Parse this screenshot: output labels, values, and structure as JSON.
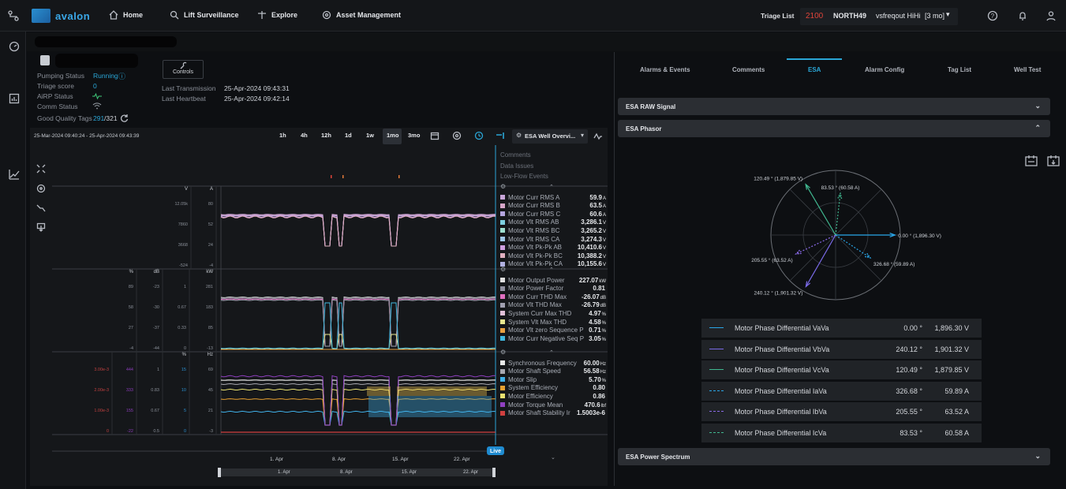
{
  "topbar": {
    "brand": "avalon",
    "nav": [
      "Home",
      "Lift Surveillance",
      "Explore",
      "Asset Management"
    ],
    "triage_label": "Triage List",
    "triage_count": "2100",
    "well": "NORTH49",
    "alarm": "vsfreqout HiHi",
    "period": "[3 mo]"
  },
  "well_info": {
    "pumping_status_label": "Pumping Status",
    "pumping_status_value": "Running",
    "triage_score_label": "Triage score",
    "triage_score_value": "0",
    "airp_label": "AiRP Status",
    "comm_label": "Comm Status",
    "good_tags_label": "Good Quality Tags",
    "good_tags_value": "291",
    "good_tags_total": "/321",
    "controls_label": "Controls",
    "last_tx_label": "Last Transmission",
    "last_tx_value": "25-Apr-2024 09:43:31",
    "last_hb_label": "Last Heartbeat",
    "last_hb_value": "25-Apr-2024 09:42:14"
  },
  "chart_toolbar": {
    "range": "25-Mar-2024 09:40:24 - 25-Apr-2024 09:43:39",
    "buttons": [
      "1h",
      "4h",
      "12h",
      "1d",
      "1w",
      "1mo",
      "3mo"
    ],
    "active": "1mo",
    "view_select": "ESA Well Overvi..."
  },
  "event_lanes": [
    "Comments",
    "Data Issues",
    "Low-Flow Events"
  ],
  "x_axis": {
    "ticks": [
      "1. Apr",
      "8. Apr",
      "15. Apr",
      "22. Apr"
    ],
    "live_label": "Live"
  },
  "colors": {
    "accent": "#2aa6d6",
    "status_ok": "#2aa6d6",
    "triage": "#e0443a",
    "panel": "#15171a"
  },
  "chart_data": [
    {
      "type": "line",
      "y_axes": [
        {
          "unit": "V",
          "ticks": [
            "12.05k",
            "7860",
            "3668",
            "-524"
          ]
        },
        {
          "unit": "A",
          "ticks": [
            "80",
            "52",
            "24",
            "-4"
          ]
        }
      ],
      "series": [
        {
          "name": "Motor Curr RMS A",
          "value": "59.9",
          "unit": "A",
          "color": "#c9a6d9"
        },
        {
          "name": "Motor Curr RMS B",
          "value": "63.5",
          "unit": "A",
          "color": "#d6a6c9"
        },
        {
          "name": "Motor Curr RMS C",
          "value": "60.6",
          "unit": "A",
          "color": "#b5a6e0"
        },
        {
          "name": "Motor Vlt RMS AB",
          "value": "3,286.1",
          "unit": "V",
          "color": "#7ed0e0"
        },
        {
          "name": "Motor Vlt RMS BC",
          "value": "3,265.2",
          "unit": "V",
          "color": "#9ee0d0"
        },
        {
          "name": "Motor Vlt RMS CA",
          "value": "3,274.3",
          "unit": "V",
          "color": "#a0c8e8"
        },
        {
          "name": "Motor Vlt Pk-Pk AB",
          "value": "10,410.6",
          "unit": "V",
          "color": "#d0a0e0"
        },
        {
          "name": "Motor Vlt Pk-Pk BC",
          "value": "10,388.2",
          "unit": "V",
          "color": "#e0b0c0"
        },
        {
          "name": "Motor Vlt Pk-Pk CA",
          "value": "10,155.6",
          "unit": "V",
          "color": "#b0b0e0"
        }
      ]
    },
    {
      "type": "line",
      "y_axes": [
        {
          "unit": "%",
          "ticks": [
            "89",
            "58",
            "27",
            "-4"
          ]
        },
        {
          "unit": "dB",
          "ticks": [
            "-23",
            "-30",
            "-37",
            "-44"
          ]
        },
        {
          "unit": "",
          "ticks": [
            "1",
            "0.67",
            "0.33",
            "0"
          ]
        },
        {
          "unit": "kW",
          "ticks": [
            "281",
            "183",
            "85",
            "-13"
          ]
        }
      ],
      "series": [
        {
          "name": "Motor Output Power",
          "value": "227.07",
          "unit": "kW",
          "color": "#e0e0e0"
        },
        {
          "name": "Motor Power Factor",
          "value": "0.81",
          "unit": "",
          "color": "#9090a0"
        },
        {
          "name": "Motor Curr THD Max",
          "value": "-26.07",
          "unit": "dB",
          "color": "#e070c0"
        },
        {
          "name": "Motor Vlt THD Max",
          "value": "-26.79",
          "unit": "dB",
          "color": "#a0a0b0"
        },
        {
          "name": "System Curr Max THD",
          "value": "4.97",
          "unit": "%",
          "color": "#e0c0d8"
        },
        {
          "name": "System Vlt Max THD",
          "value": "4.58",
          "unit": "%",
          "color": "#e8e890"
        },
        {
          "name": "Motor Vlt zero Sequence P",
          "value": "0.71",
          "unit": "%",
          "color": "#e8a040"
        },
        {
          "name": "Motor Curr Negative Seq P",
          "value": "3.05",
          "unit": "%",
          "color": "#40b8e0"
        }
      ]
    },
    {
      "type": "line",
      "y_axes": [
        {
          "unit": "",
          "ticks": [
            "3.00e-3",
            "2.00e-3",
            "1.00e-3",
            "0"
          ]
        },
        {
          "unit": "",
          "ticks": [
            "444",
            "333",
            "155",
            "-22"
          ]
        },
        {
          "unit": "",
          "ticks": [
            "1",
            "0.83",
            "0.67",
            "0.5"
          ]
        },
        {
          "unit": "%",
          "ticks": [
            "15",
            "10",
            "5",
            "0"
          ]
        },
        {
          "unit": "Hz",
          "ticks": [
            "69",
            "45",
            "21",
            "-3"
          ]
        }
      ],
      "series": [
        {
          "name": "Synchronous Frequency",
          "value": "60.00",
          "unit": "Hz",
          "color": "#e8e8e8"
        },
        {
          "name": "Motor Shaft Speed",
          "value": "56.58",
          "unit": "Hz",
          "color": "#a8a8b0"
        },
        {
          "name": "Motor Slip",
          "value": "5.70",
          "unit": "%",
          "color": "#40b0e8"
        },
        {
          "name": "System Efficiency",
          "value": "0.80",
          "unit": "",
          "color": "#e8a030"
        },
        {
          "name": "Motor Efficiency",
          "value": "0.86",
          "unit": "",
          "color": "#e8e070"
        },
        {
          "name": "Motor Torque Mean",
          "value": "470.6",
          "unit": "lbf",
          "color": "#9040c0"
        },
        {
          "name": "Motor Shaft Stability Ir",
          "value": "1.5003e-6",
          "unit": "",
          "color": "#d04040"
        }
      ]
    },
    {
      "type": "scatter",
      "title": "ESA Phasor",
      "polar": true,
      "series": [
        {
          "name": "Motor Phase Differential VaVa",
          "angle": 0.0,
          "magnitude": 1896.3,
          "unit": "V",
          "color": "#2aa6e8",
          "dashed": false,
          "label": "0.00 ° (1,896.30 V)"
        },
        {
          "name": "Motor Phase Differential VbVa",
          "angle": 240.12,
          "magnitude": 1901.32,
          "unit": "V",
          "color": "#7a6ae8",
          "dashed": false,
          "label": "240.12 ° (1,901.32 V)"
        },
        {
          "name": "Motor Phase Differential VcVa",
          "angle": 120.49,
          "magnitude": 1879.85,
          "unit": "V",
          "color": "#40b890",
          "dashed": false,
          "label": "120.49 ° (1,879.85 V)"
        },
        {
          "name": "Motor Phase Differential IaVa",
          "angle": 326.68,
          "magnitude": 59.89,
          "unit": "A",
          "color": "#2aa6e8",
          "dashed": true,
          "label": "326.68 ° (59.89 A)"
        },
        {
          "name": "Motor Phase Differential IbVa",
          "angle": 205.55,
          "magnitude": 63.52,
          "unit": "A",
          "color": "#8a6ae8",
          "dashed": true,
          "label": "205.55 ° (63.52 A)"
        },
        {
          "name": "Motor Phase Differential IcVa",
          "angle": 83.53,
          "magnitude": 60.58,
          "unit": "A",
          "color": "#40b890",
          "dashed": true,
          "label": "83.53 ° (60.58 A)"
        }
      ]
    }
  ],
  "right_tabs": [
    "Alarms & Events",
    "Comments",
    "ESA",
    "Alarm Config",
    "Tag List",
    "Well Test"
  ],
  "right_active_tab": "ESA",
  "sections": {
    "raw": "ESA RAW Signal",
    "phasor": "ESA Phasor",
    "spectrum": "ESA Power Spectrum"
  },
  "phasor_table": [
    {
      "name": "Motor Phase Differential VaVa",
      "deg": "0.00 °",
      "mag": "1,896.30 V"
    },
    {
      "name": "Motor Phase Differential VbVa",
      "deg": "240.12 °",
      "mag": "1,901.32 V"
    },
    {
      "name": "Motor Phase Differential VcVa",
      "deg": "120.49 °",
      "mag": "1,879.85 V"
    },
    {
      "name": "Motor Phase Differential IaVa",
      "deg": "326.68 °",
      "mag": "59.89 A"
    },
    {
      "name": "Motor Phase Differential IbVa",
      "deg": "205.55 °",
      "mag": "63.52 A"
    },
    {
      "name": "Motor Phase Differential IcVa",
      "deg": "83.53 °",
      "mag": "60.58 A"
    }
  ]
}
